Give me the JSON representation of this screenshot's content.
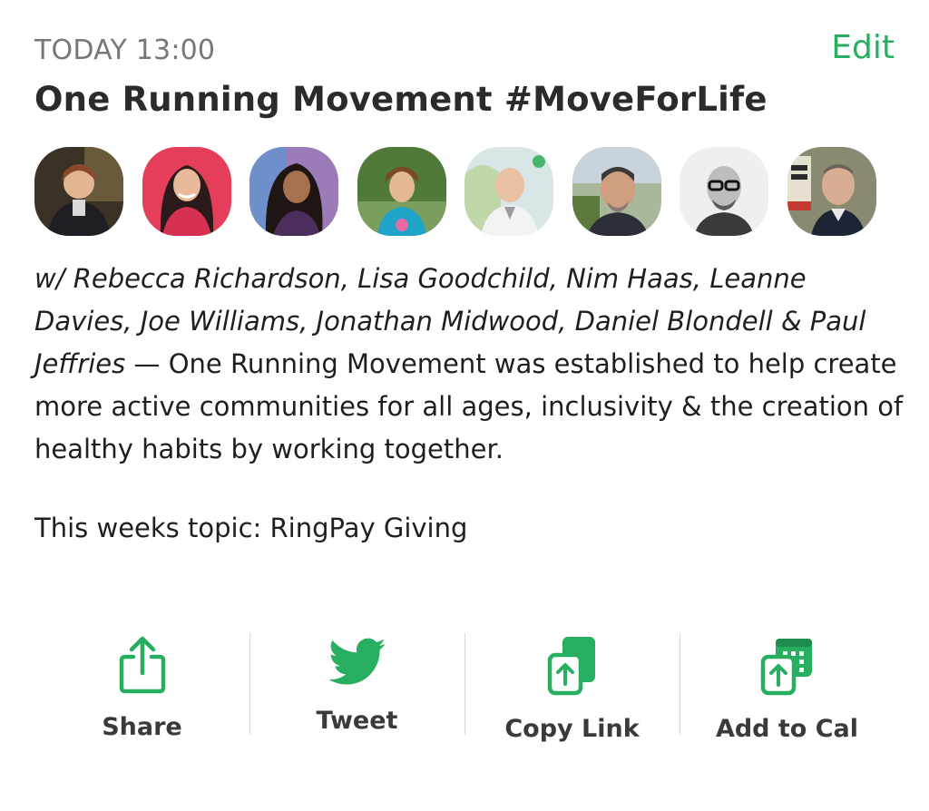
{
  "event": {
    "time": "TODAY 13:00",
    "edit_label": "Edit",
    "title": "One Running Movement #MoveForLife",
    "hosts_text": "w/ Rebecca Richardson, Lisa Goodchild, Nim Haas, Leanne Davies, Joe Williams, Jonathan Midwood, Daniel Blondell & Paul Jeffries",
    "description": " — One Running Movement was established to help create more active communities for all ages, inclusivity & the creation of healthy habits by working together.",
    "topic": "This weeks topic: RingPay Giving"
  },
  "actions": {
    "share": "Share",
    "tweet": "Tweet",
    "copy_link": "Copy Link",
    "add_to_cal": "Add to Cal"
  },
  "colors": {
    "accent": "#27ae60",
    "time_text": "#777777",
    "title_text": "#2b2b2b"
  }
}
